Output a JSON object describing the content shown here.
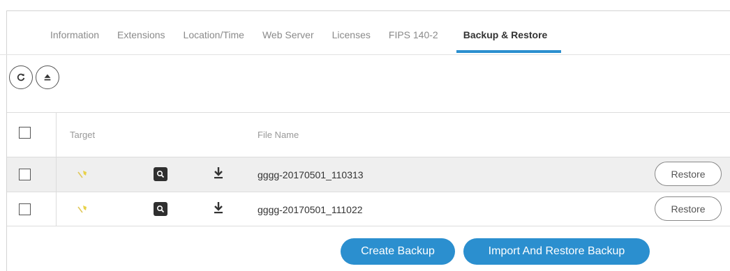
{
  "tabs": [
    {
      "label": "Information",
      "active": false
    },
    {
      "label": "Extensions",
      "active": false
    },
    {
      "label": "Location/Time",
      "active": false
    },
    {
      "label": "Web Server",
      "active": false
    },
    {
      "label": "Licenses",
      "active": false
    },
    {
      "label": "FIPS 140-2",
      "active": false
    },
    {
      "label": "Backup & Restore",
      "active": true
    }
  ],
  "toolbar": {
    "refresh_icon": "refresh-icon",
    "upload_icon": "eject-upload-icon"
  },
  "table": {
    "headers": {
      "target": "Target",
      "file_name": "File Name"
    },
    "rows": [
      {
        "file_name": "gggg-20170501_110313",
        "action": "Restore"
      },
      {
        "file_name": "gggg-20170501_111022",
        "action": "Restore"
      }
    ]
  },
  "footer": {
    "create_label": "Create Backup",
    "import_label": "Import And Restore Backup"
  },
  "colors": {
    "accent": "#2b8fcf",
    "target_icon": "#e8d24a"
  }
}
